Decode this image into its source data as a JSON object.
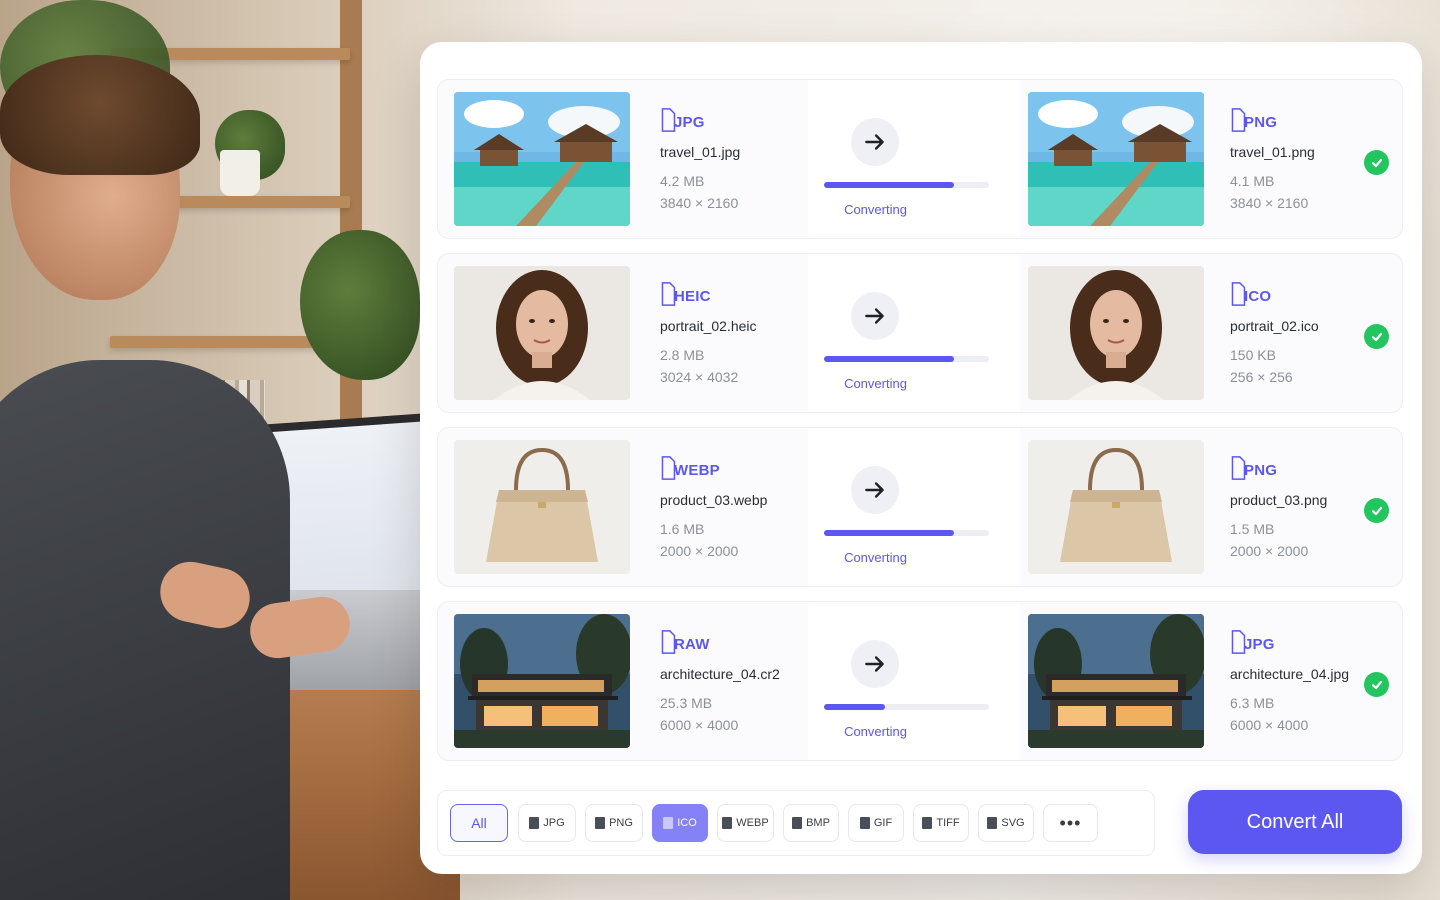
{
  "colors": {
    "accent": "#5b57f0",
    "accent_light": "#8581f6",
    "success": "#22c55e",
    "muted_text": "#8c909a"
  },
  "conversions": [
    {
      "source": {
        "format": "JPG",
        "filename": "travel_01.jpg",
        "size": "4.2 MB",
        "dimensions": "3840 × 2160",
        "image": "overwater-bungalows-photo"
      },
      "status": "Converting",
      "progress": 0.79,
      "target": {
        "format": "PNG",
        "filename": "travel_01.png",
        "size": "4.1 MB",
        "dimensions": "3840 × 2160",
        "image": "overwater-bungalows-photo"
      },
      "done": true
    },
    {
      "source": {
        "format": "HEIC",
        "filename": "portrait_02.heic",
        "size": "2.8 MB",
        "dimensions": "3024 × 4032",
        "image": "woman-portrait-photo"
      },
      "status": "Converting",
      "progress": 0.79,
      "target": {
        "format": "ICO",
        "filename": "portrait_02.ico",
        "size": "150 KB",
        "dimensions": "256 × 256",
        "image": "woman-portrait-photo"
      },
      "done": true
    },
    {
      "source": {
        "format": "WEBP",
        "filename": "product_03.webp",
        "size": "1.6 MB",
        "dimensions": "2000 × 2000",
        "image": "handbag-product-photo"
      },
      "status": "Converting",
      "progress": 0.79,
      "target": {
        "format": "PNG",
        "filename": "product_03.png",
        "size": "1.5 MB",
        "dimensions": "2000 × 2000",
        "image": "handbag-product-photo"
      },
      "done": true
    },
    {
      "source": {
        "format": "RAW",
        "filename": "architecture_04.cr2",
        "size": "25.3 MB",
        "dimensions": "6000 × 4000",
        "image": "modern-house-photo"
      },
      "status": "Converting",
      "progress": 0.37,
      "target": {
        "format": "JPG",
        "filename": "architecture_04.jpg",
        "size": "6.3 MB",
        "dimensions": "6000 × 4000",
        "image": "modern-house-photo"
      },
      "done": true
    }
  ],
  "format_filter": {
    "all_label": "All",
    "formats": [
      "JPG",
      "PNG",
      "ICO",
      "WEBP",
      "BMP",
      "GIF",
      "TIFF",
      "SVG"
    ],
    "selected": [
      "All",
      "ICO"
    ],
    "more_label": "•••"
  },
  "actions": {
    "convert_all_label": "Convert All"
  }
}
